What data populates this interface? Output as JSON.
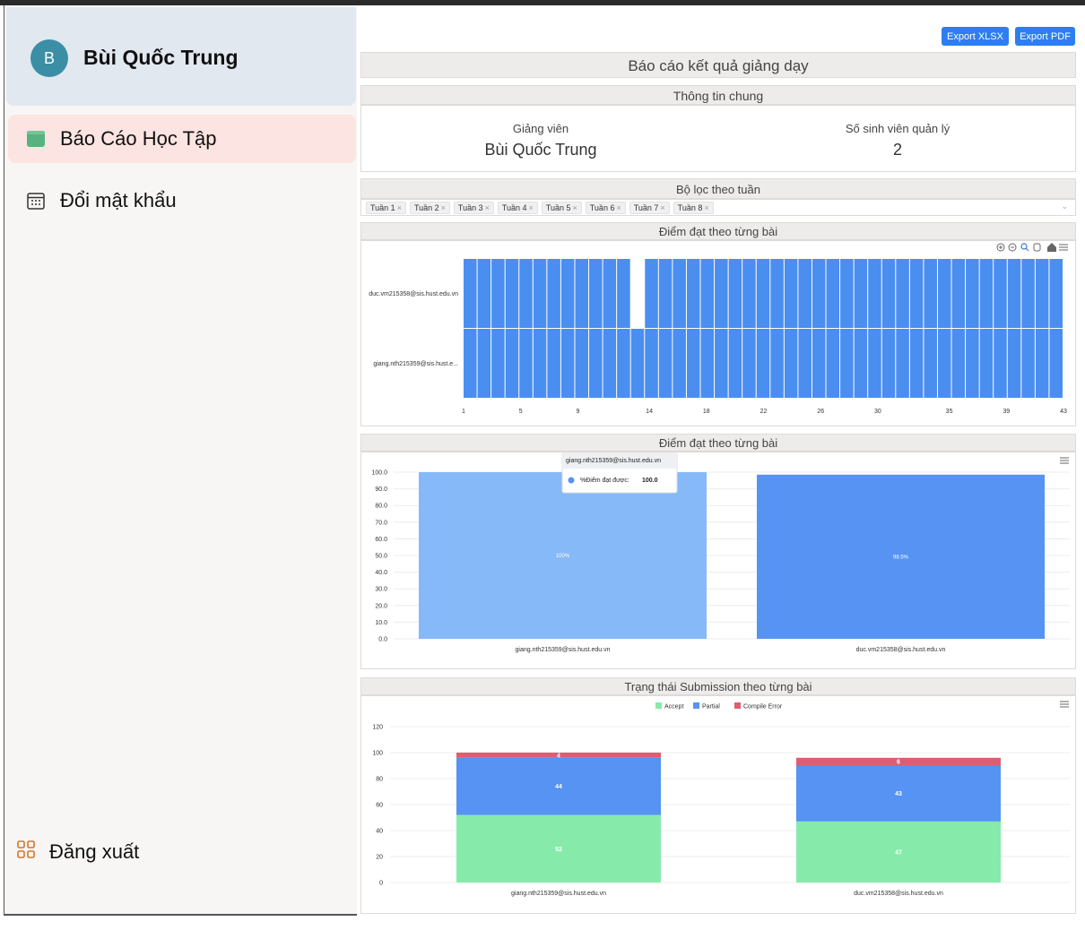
{
  "user": {
    "initial": "B",
    "name": "Bùi Quốc Trung"
  },
  "sidebar": {
    "items": [
      {
        "label": "Báo Cáo Học Tập",
        "icon": "report-icon",
        "active": true
      },
      {
        "label": "Đổi mật khẩu",
        "icon": "calendar-icon",
        "active": false
      }
    ],
    "logout_label": "Đăng xuất"
  },
  "toolbar": {
    "export_xlsx": "Export XLSX",
    "export_pdf": "Export PDF"
  },
  "page_title": "Báo cáo kết quả giảng dạy",
  "general_info": {
    "title": "Thông tin chung",
    "teacher_label": "Giảng viên",
    "teacher_value": "Bùi Quốc Trung",
    "students_label": "Số sinh viên quản lý",
    "students_value": "2"
  },
  "week_filter": {
    "title": "Bộ lọc theo tuần",
    "tags": [
      "Tuần 1",
      "Tuần 2",
      "Tuần 3",
      "Tuần 4",
      "Tuần 5",
      "Tuần 6",
      "Tuần 7",
      "Tuần 8"
    ]
  },
  "colors": {
    "primary": "#2d7ff0",
    "bar_blue": "#4a8ef0",
    "accept": "#86ebaa",
    "partial": "#5693f2",
    "compile_error": "#e05c70"
  },
  "chart_data": [
    {
      "type": "heatmap",
      "title": "Điểm đạt theo từng bài",
      "rows": [
        "duc.vm215358@sis.hust.edu.vn",
        "giang.nth215359@sis.hust.e..."
      ],
      "x_ticks": [
        "1",
        "5",
        "9",
        "14",
        "18",
        "22",
        "26",
        "30",
        "35",
        "39",
        "43"
      ],
      "x_count": 43,
      "missing": [
        {
          "row": 0,
          "col": 12
        }
      ]
    },
    {
      "type": "bar",
      "title": "Điểm đạt theo từng bài",
      "categories": [
        "giang.nth215359@sis.hust.edu.vn",
        "duc.vm215358@sis.hust.edu.vn"
      ],
      "values": [
        100.0,
        98.5
      ],
      "data_labels": [
        "100%",
        "98.5%"
      ],
      "y_ticks": [
        "0.0",
        "10.0",
        "20.0",
        "30.0",
        "40.0",
        "50.0",
        "60.0",
        "70.0",
        "80.0",
        "90.0",
        "100.0"
      ],
      "ylim": [
        0,
        100
      ],
      "tooltip": {
        "title": "giang.nth215359@sis.hust.edu.vn",
        "label": "%Điểm đạt được:",
        "value": "100.0"
      }
    },
    {
      "type": "bar",
      "stacked": true,
      "title": "Trạng thái Submission theo từng bài",
      "categories": [
        "giang.nth215359@sis.hust.edu.vn",
        "duc.vm215358@sis.hust.edu.vn"
      ],
      "series": [
        {
          "name": "Accept",
          "values": [
            52,
            47
          ]
        },
        {
          "name": "Partial",
          "values": [
            44,
            43
          ]
        },
        {
          "name": "Compile Error",
          "values": [
            4,
            6
          ]
        }
      ],
      "y_ticks": [
        "0",
        "20",
        "40",
        "60",
        "80",
        "100",
        "120"
      ],
      "ylim": [
        0,
        120
      ],
      "legend": "top-center"
    }
  ]
}
